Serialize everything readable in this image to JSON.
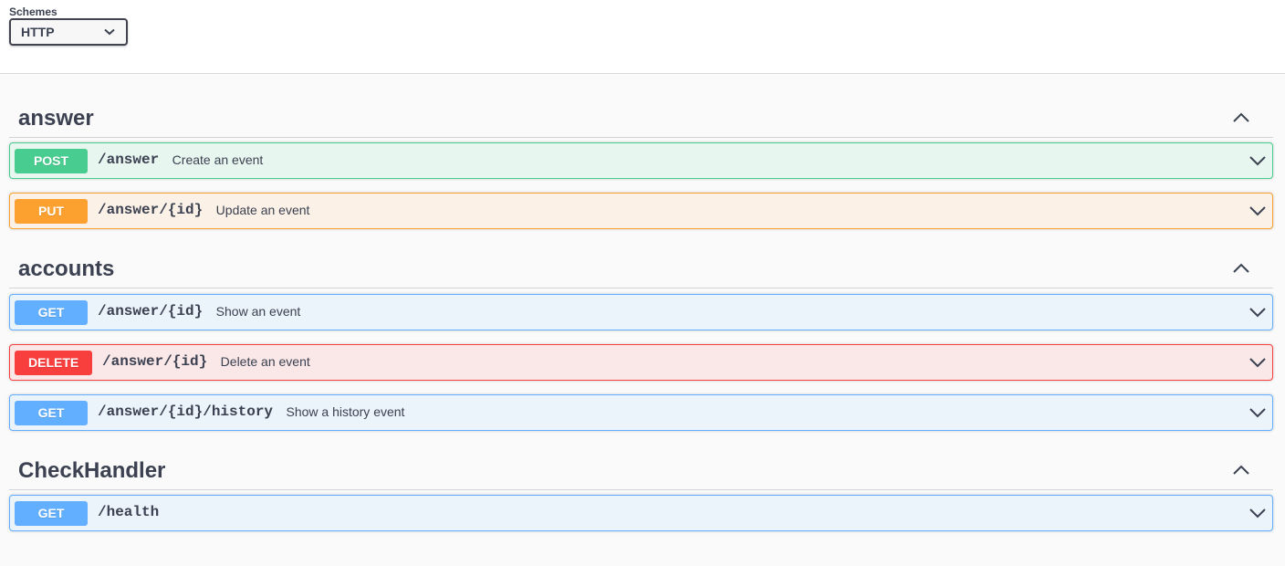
{
  "schemes": {
    "label": "Schemes",
    "selected": "HTTP"
  },
  "sections": [
    {
      "name": "answer",
      "operations": [
        {
          "method": "POST",
          "path": "/answer",
          "summary": "Create an event",
          "color": "#49cc90"
        },
        {
          "method": "PUT",
          "path": "/answer/{id}",
          "summary": "Update an event",
          "color": "#fca130"
        }
      ]
    },
    {
      "name": "accounts",
      "operations": [
        {
          "method": "GET",
          "path": "/answer/{id}",
          "summary": "Show an event",
          "color": "#61affe"
        },
        {
          "method": "DELETE",
          "path": "/answer/{id}",
          "summary": "Delete an event",
          "color": "#f93e3e"
        },
        {
          "method": "GET",
          "path": "/answer/{id}/history",
          "summary": "Show a history event",
          "color": "#61affe"
        }
      ]
    },
    {
      "name": "CheckHandler",
      "operations": [
        {
          "method": "GET",
          "path": "/health",
          "summary": "",
          "color": "#61affe"
        }
      ]
    }
  ],
  "icons": {
    "scheme_dropdown": "chevron-down-icon",
    "section_toggle": "chevron-up-icon",
    "operation_expand": "chevron-down-icon"
  }
}
